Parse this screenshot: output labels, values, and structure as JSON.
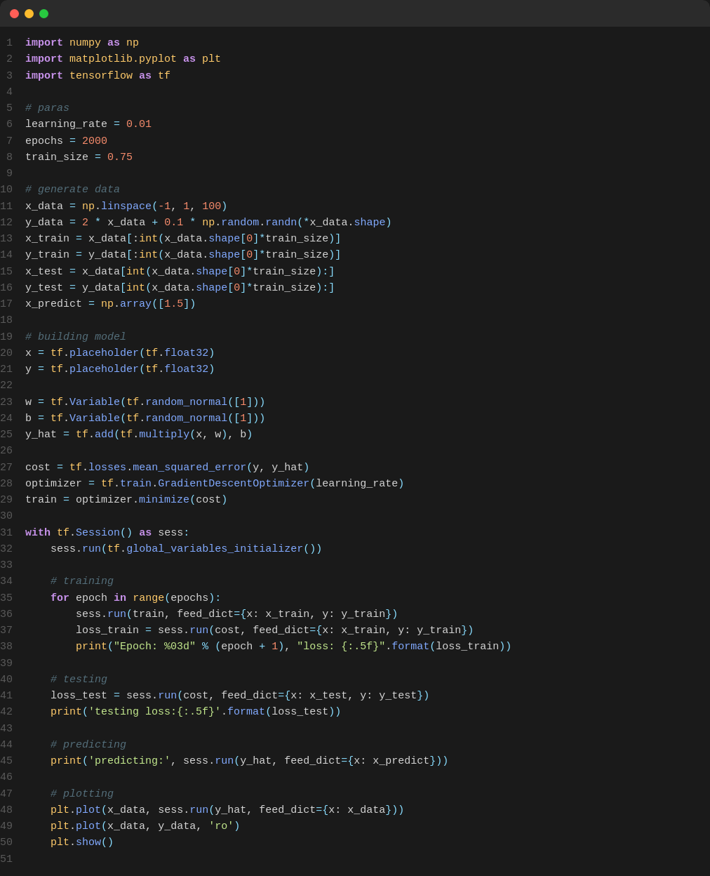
{
  "titleBar": {
    "buttons": [
      "close",
      "minimize",
      "maximize"
    ]
  },
  "lines": [
    {
      "ln": "1",
      "html": "<span class='kw'>import</span> <span class='mod'>numpy</span> <span class='kw'>as</span> <span class='mod'>np</span>"
    },
    {
      "ln": "2",
      "html": "<span class='kw'>import</span> <span class='mod'>matplotlib.pyplot</span> <span class='kw'>as</span> <span class='mod'>plt</span>"
    },
    {
      "ln": "3",
      "html": "<span class='kw'>import</span> <span class='mod'>tensorflow</span> <span class='kw'>as</span> <span class='mod'>tf</span>"
    },
    {
      "ln": "4",
      "html": ""
    },
    {
      "ln": "5",
      "html": "<span class='cm'># paras</span>"
    },
    {
      "ln": "6",
      "html": "<span class='var'>learning_rate</span> <span class='op'>=</span> <span class='num'>0.01</span>"
    },
    {
      "ln": "7",
      "html": "<span class='var'>epochs</span> <span class='op'>=</span> <span class='num'>2000</span>"
    },
    {
      "ln": "8",
      "html": "<span class='var'>train_size</span> <span class='op'>=</span> <span class='num'>0.75</span>"
    },
    {
      "ln": "9",
      "html": ""
    },
    {
      "ln": "10",
      "html": "<span class='cm'># generate data</span>"
    },
    {
      "ln": "11",
      "html": "<span class='var'>x_data</span> <span class='op'>=</span> <span class='mod'>np</span>.<span class='fn'>linspace</span><span class='paren'>(</span><span class='num'>-1</span>, <span class='num'>1</span>, <span class='num'>100</span><span class='paren'>)</span>"
    },
    {
      "ln": "12",
      "html": "<span class='var'>y_data</span> <span class='op'>=</span> <span class='num'>2</span> <span class='op'>*</span> <span class='var'>x_data</span> <span class='op'>+</span> <span class='num'>0.1</span> <span class='op'>*</span> <span class='mod'>np</span>.<span class='fn'>random</span>.<span class='fn'>randn</span><span class='paren'>(</span><span class='op'>*</span><span class='var'>x_data</span>.<span class='attr'>shape</span><span class='paren'>)</span>"
    },
    {
      "ln": "13",
      "html": "<span class='var'>x_train</span> <span class='op'>=</span> <span class='var'>x_data</span><span class='paren'>[</span>:<span class='builtin'>int</span><span class='paren'>(</span><span class='var'>x_data</span>.<span class='attr'>shape</span><span class='paren'>[</span><span class='num'>0</span><span class='paren'>]</span><span class='op'>*</span><span class='var'>train_size</span><span class='paren'>)]</span>"
    },
    {
      "ln": "14",
      "html": "<span class='var'>y_train</span> <span class='op'>=</span> <span class='var'>y_data</span><span class='paren'>[</span>:<span class='builtin'>int</span><span class='paren'>(</span><span class='var'>x_data</span>.<span class='attr'>shape</span><span class='paren'>[</span><span class='num'>0</span><span class='paren'>]</span><span class='op'>*</span><span class='var'>train_size</span><span class='paren'>)]</span>"
    },
    {
      "ln": "15",
      "html": "<span class='var'>x_test</span> <span class='op'>=</span> <span class='var'>x_data</span><span class='paren'>[</span><span class='builtin'>int</span><span class='paren'>(</span><span class='var'>x_data</span>.<span class='attr'>shape</span><span class='paren'>[</span><span class='num'>0</span><span class='paren'>]</span><span class='op'>*</span><span class='var'>train_size</span><span class='paren'>):</span><span class='paren'>]</span>"
    },
    {
      "ln": "16",
      "html": "<span class='var'>y_test</span> <span class='op'>=</span> <span class='var'>y_data</span><span class='paren'>[</span><span class='builtin'>int</span><span class='paren'>(</span><span class='var'>x_data</span>.<span class='attr'>shape</span><span class='paren'>[</span><span class='num'>0</span><span class='paren'>]</span><span class='op'>*</span><span class='var'>train_size</span><span class='paren'>):</span><span class='paren'>]</span>"
    },
    {
      "ln": "17",
      "html": "<span class='var'>x_predict</span> <span class='op'>=</span> <span class='mod'>np</span>.<span class='fn'>array</span><span class='paren'>([</span><span class='num'>1.5</span><span class='paren'>])</span>"
    },
    {
      "ln": "18",
      "html": ""
    },
    {
      "ln": "19",
      "html": "<span class='cm'># building model</span>"
    },
    {
      "ln": "20",
      "html": "<span class='var'>x</span> <span class='op'>=</span> <span class='mod'>tf</span>.<span class='fn'>placeholder</span><span class='paren'>(</span><span class='mod'>tf</span>.<span class='attr'>float32</span><span class='paren'>)</span>"
    },
    {
      "ln": "21",
      "html": "<span class='var'>y</span> <span class='op'>=</span> <span class='mod'>tf</span>.<span class='fn'>placeholder</span><span class='paren'>(</span><span class='mod'>tf</span>.<span class='attr'>float32</span><span class='paren'>)</span>"
    },
    {
      "ln": "22",
      "html": ""
    },
    {
      "ln": "23",
      "html": "<span class='var'>w</span> <span class='op'>=</span> <span class='mod'>tf</span>.<span class='fn'>Variable</span><span class='paren'>(</span><span class='mod'>tf</span>.<span class='fn'>random_normal</span><span class='paren'>([</span><span class='num'>1</span><span class='paren'>]))</span>"
    },
    {
      "ln": "24",
      "html": "<span class='var'>b</span> <span class='op'>=</span> <span class='mod'>tf</span>.<span class='fn'>Variable</span><span class='paren'>(</span><span class='mod'>tf</span>.<span class='fn'>random_normal</span><span class='paren'>([</span><span class='num'>1</span><span class='paren'>]))</span>"
    },
    {
      "ln": "25",
      "html": "<span class='var'>y_hat</span> <span class='op'>=</span> <span class='mod'>tf</span>.<span class='fn'>add</span><span class='paren'>(</span><span class='mod'>tf</span>.<span class='fn'>multiply</span><span class='paren'>(</span><span class='var'>x</span>, <span class='var'>w</span><span class='paren'>)</span>, <span class='var'>b</span><span class='paren'>)</span>"
    },
    {
      "ln": "26",
      "html": ""
    },
    {
      "ln": "27",
      "html": "<span class='var'>cost</span> <span class='op'>=</span> <span class='mod'>tf</span>.<span class='attr'>losses</span>.<span class='fn'>mean_squared_error</span><span class='paren'>(</span><span class='var'>y</span>, <span class='var'>y_hat</span><span class='paren'>)</span>"
    },
    {
      "ln": "28",
      "html": "<span class='var'>optimizer</span> <span class='op'>=</span> <span class='mod'>tf</span>.<span class='attr'>train</span>.<span class='fn'>GradientDescentOptimizer</span><span class='paren'>(</span><span class='var'>learning_rate</span><span class='paren'>)</span>"
    },
    {
      "ln": "29",
      "html": "<span class='var'>train</span> <span class='op'>=</span> <span class='var'>optimizer</span>.<span class='fn'>minimize</span><span class='paren'>(</span><span class='var'>cost</span><span class='paren'>)</span>"
    },
    {
      "ln": "30",
      "html": ""
    },
    {
      "ln": "31",
      "html": "<span class='kw'>with</span> <span class='mod'>tf</span>.<span class='fn'>Session</span><span class='paren'>()</span> <span class='kw'>as</span> <span class='var'>sess</span><span class='paren'>:</span>"
    },
    {
      "ln": "32",
      "html": "    <span class='var'>sess</span>.<span class='fn'>run</span><span class='paren'>(</span><span class='mod'>tf</span>.<span class='fn'>global_variables_initializer</span><span class='paren'>())</span>"
    },
    {
      "ln": "33",
      "html": ""
    },
    {
      "ln": "34",
      "html": "    <span class='cm'># training</span>"
    },
    {
      "ln": "35",
      "html": "    <span class='kw'>for</span> <span class='var'>epoch</span> <span class='kw'>in</span> <span class='builtin'>range</span><span class='paren'>(</span><span class='var'>epochs</span><span class='paren'>)</span><span class='paren'>:</span>"
    },
    {
      "ln": "36",
      "html": "        <span class='var'>sess</span>.<span class='fn'>run</span><span class='paren'>(</span><span class='var'>train</span>, <span class='var'>feed_dict</span><span class='op'>=</span><span class='paren'>{</span><span class='var'>x</span>: <span class='var'>x_train</span>, <span class='var'>y</span>: <span class='var'>y_train</span><span class='paren'>})</span>"
    },
    {
      "ln": "37",
      "html": "        <span class='var'>loss_train</span> <span class='op'>=</span> <span class='var'>sess</span>.<span class='fn'>run</span><span class='paren'>(</span><span class='var'>cost</span>, <span class='var'>feed_dict</span><span class='op'>=</span><span class='paren'>{</span><span class='var'>x</span>: <span class='var'>x_train</span>, <span class='var'>y</span>: <span class='var'>y_train</span><span class='paren'>})</span>"
    },
    {
      "ln": "38",
      "html": "        <span class='builtin'>print</span><span class='paren'>(</span><span class='str'>\"Epoch: %03d\"</span> <span class='op'>%</span> <span class='paren'>(</span><span class='var'>epoch</span> <span class='op'>+</span> <span class='num'>1</span><span class='paren'>)</span>, <span class='str'>\"loss: {:.5f}\"</span>.<span class='fn'>format</span><span class='paren'>(</span><span class='var'>loss_train</span><span class='paren'>))</span>"
    },
    {
      "ln": "39",
      "html": ""
    },
    {
      "ln": "40",
      "html": "    <span class='cm'># testing</span>"
    },
    {
      "ln": "41",
      "html": "    <span class='var'>loss_test</span> <span class='op'>=</span> <span class='var'>sess</span>.<span class='fn'>run</span><span class='paren'>(</span><span class='var'>cost</span>, <span class='var'>feed_dict</span><span class='op'>=</span><span class='paren'>{</span><span class='var'>x</span>: <span class='var'>x_test</span>, <span class='var'>y</span>: <span class='var'>y_test</span><span class='paren'>})</span>"
    },
    {
      "ln": "42",
      "html": "    <span class='builtin'>print</span><span class='paren'>(</span><span class='str'>'testing loss:{:.5f}'</span>.<span class='fn'>format</span><span class='paren'>(</span><span class='var'>loss_test</span><span class='paren'>))</span>"
    },
    {
      "ln": "43",
      "html": ""
    },
    {
      "ln": "44",
      "html": "    <span class='cm'># predicting</span>"
    },
    {
      "ln": "45",
      "html": "    <span class='builtin'>print</span><span class='paren'>(</span><span class='str'>'predicting:'</span>, <span class='var'>sess</span>.<span class='fn'>run</span><span class='paren'>(</span><span class='var'>y_hat</span>, <span class='var'>feed_dict</span><span class='op'>=</span><span class='paren'>{</span><span class='var'>x</span>: <span class='var'>x_predict</span><span class='paren'>}))</span>"
    },
    {
      "ln": "46",
      "html": ""
    },
    {
      "ln": "47",
      "html": "    <span class='cm'># plotting</span>"
    },
    {
      "ln": "48",
      "html": "    <span class='mod'>plt</span>.<span class='fn'>plot</span><span class='paren'>(</span><span class='var'>x_data</span>, <span class='var'>sess</span>.<span class='fn'>run</span><span class='paren'>(</span><span class='var'>y_hat</span>, <span class='var'>feed_dict</span><span class='op'>=</span><span class='paren'>{</span><span class='var'>x</span>: <span class='var'>x_data</span><span class='paren'>}))</span>"
    },
    {
      "ln": "49",
      "html": "    <span class='mod'>plt</span>.<span class='fn'>plot</span><span class='paren'>(</span><span class='var'>x_data</span>, <span class='var'>y_data</span>, <span class='str'>'ro'</span><span class='paren'>)</span>"
    },
    {
      "ln": "50",
      "html": "    <span class='mod'>plt</span>.<span class='fn'>show</span><span class='paren'>()</span>"
    },
    {
      "ln": "51",
      "html": ""
    }
  ]
}
